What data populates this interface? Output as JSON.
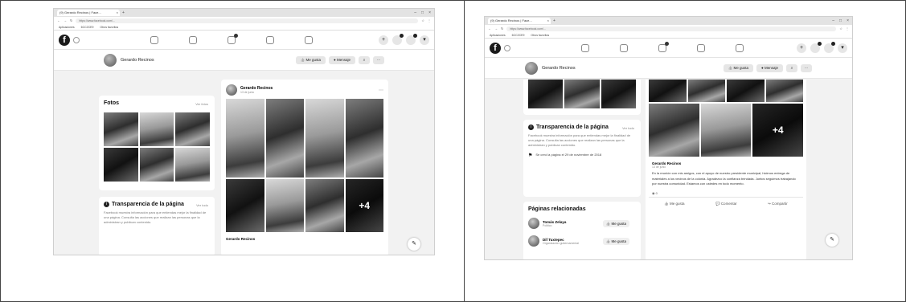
{
  "left": {
    "browser": {
      "tab_title": "(9) Gerardo Recinos | Face...",
      "url": "https://www.facebook.com/...",
      "bookmarks": [
        "Aplicaciones",
        "6CC2CE9",
        "Otros favoritos"
      ]
    },
    "profile": {
      "name": "Gerardo Recinos",
      "like_label": "Me gusta",
      "message_label": "Mensaje"
    },
    "photos": {
      "title": "Fotos",
      "link": "Ver fotos"
    },
    "transparency": {
      "title": "Transparencia de la página",
      "link": "Ver todo",
      "body": "Facebook muestra información para que entiendas mejor la finalidad de una página. Consulta las acciones que realizan las personas que la administran y publican contenido."
    },
    "post": {
      "author": "Gerardo Recinos",
      "time": "13 de junio",
      "overlay": "+4",
      "footer_author": "Gerardo Recinos"
    }
  },
  "right": {
    "browser": {
      "tab_title": "(9) Gerardo Recinos | Face...",
      "url": "https://www.facebook.com/...",
      "bookmarks": [
        "Aplicaciones",
        "6CC2CE9",
        "Otros favoritos"
      ]
    },
    "profile": {
      "name": "Gerardo Recinos",
      "like_label": "Me gusta",
      "message_label": "Mensaje"
    },
    "transparency": {
      "title": "Transparencia de la página",
      "link": "Ver todo",
      "body": "Facebook muestra información para que entiendas mejor la finalidad de una página. Consulta las acciones que realizan las personas que la administran y publican contenido.",
      "created": "Se creó la página el 29 de noviembre de 2018"
    },
    "related": {
      "title": "Páginas relacionadas",
      "pages": [
        {
          "name": "Tomás Zelaya",
          "sub": "Político",
          "like": "Me gusta"
        },
        {
          "name": "Dif Tuxtepec",
          "sub": "Organización gubernamental",
          "like": "Me gusta"
        }
      ]
    },
    "post": {
      "author": "Gerardo Recinos",
      "time": "13 de junio",
      "overlay": "+4",
      "text": "En la reunión con mis amigos, con el apoyo de nuestro presidente municipal, hicimos entrega de materiales a los vecinos de la colonia. Agradezco la confianza brindada. Juntos seguimos trabajando por nuestra comunidad. Estamos con ustedes en todo momento.",
      "reactions": "0",
      "like_action": "Me gusta",
      "comment_action": "Comentar",
      "share_action": "Compartir"
    }
  }
}
